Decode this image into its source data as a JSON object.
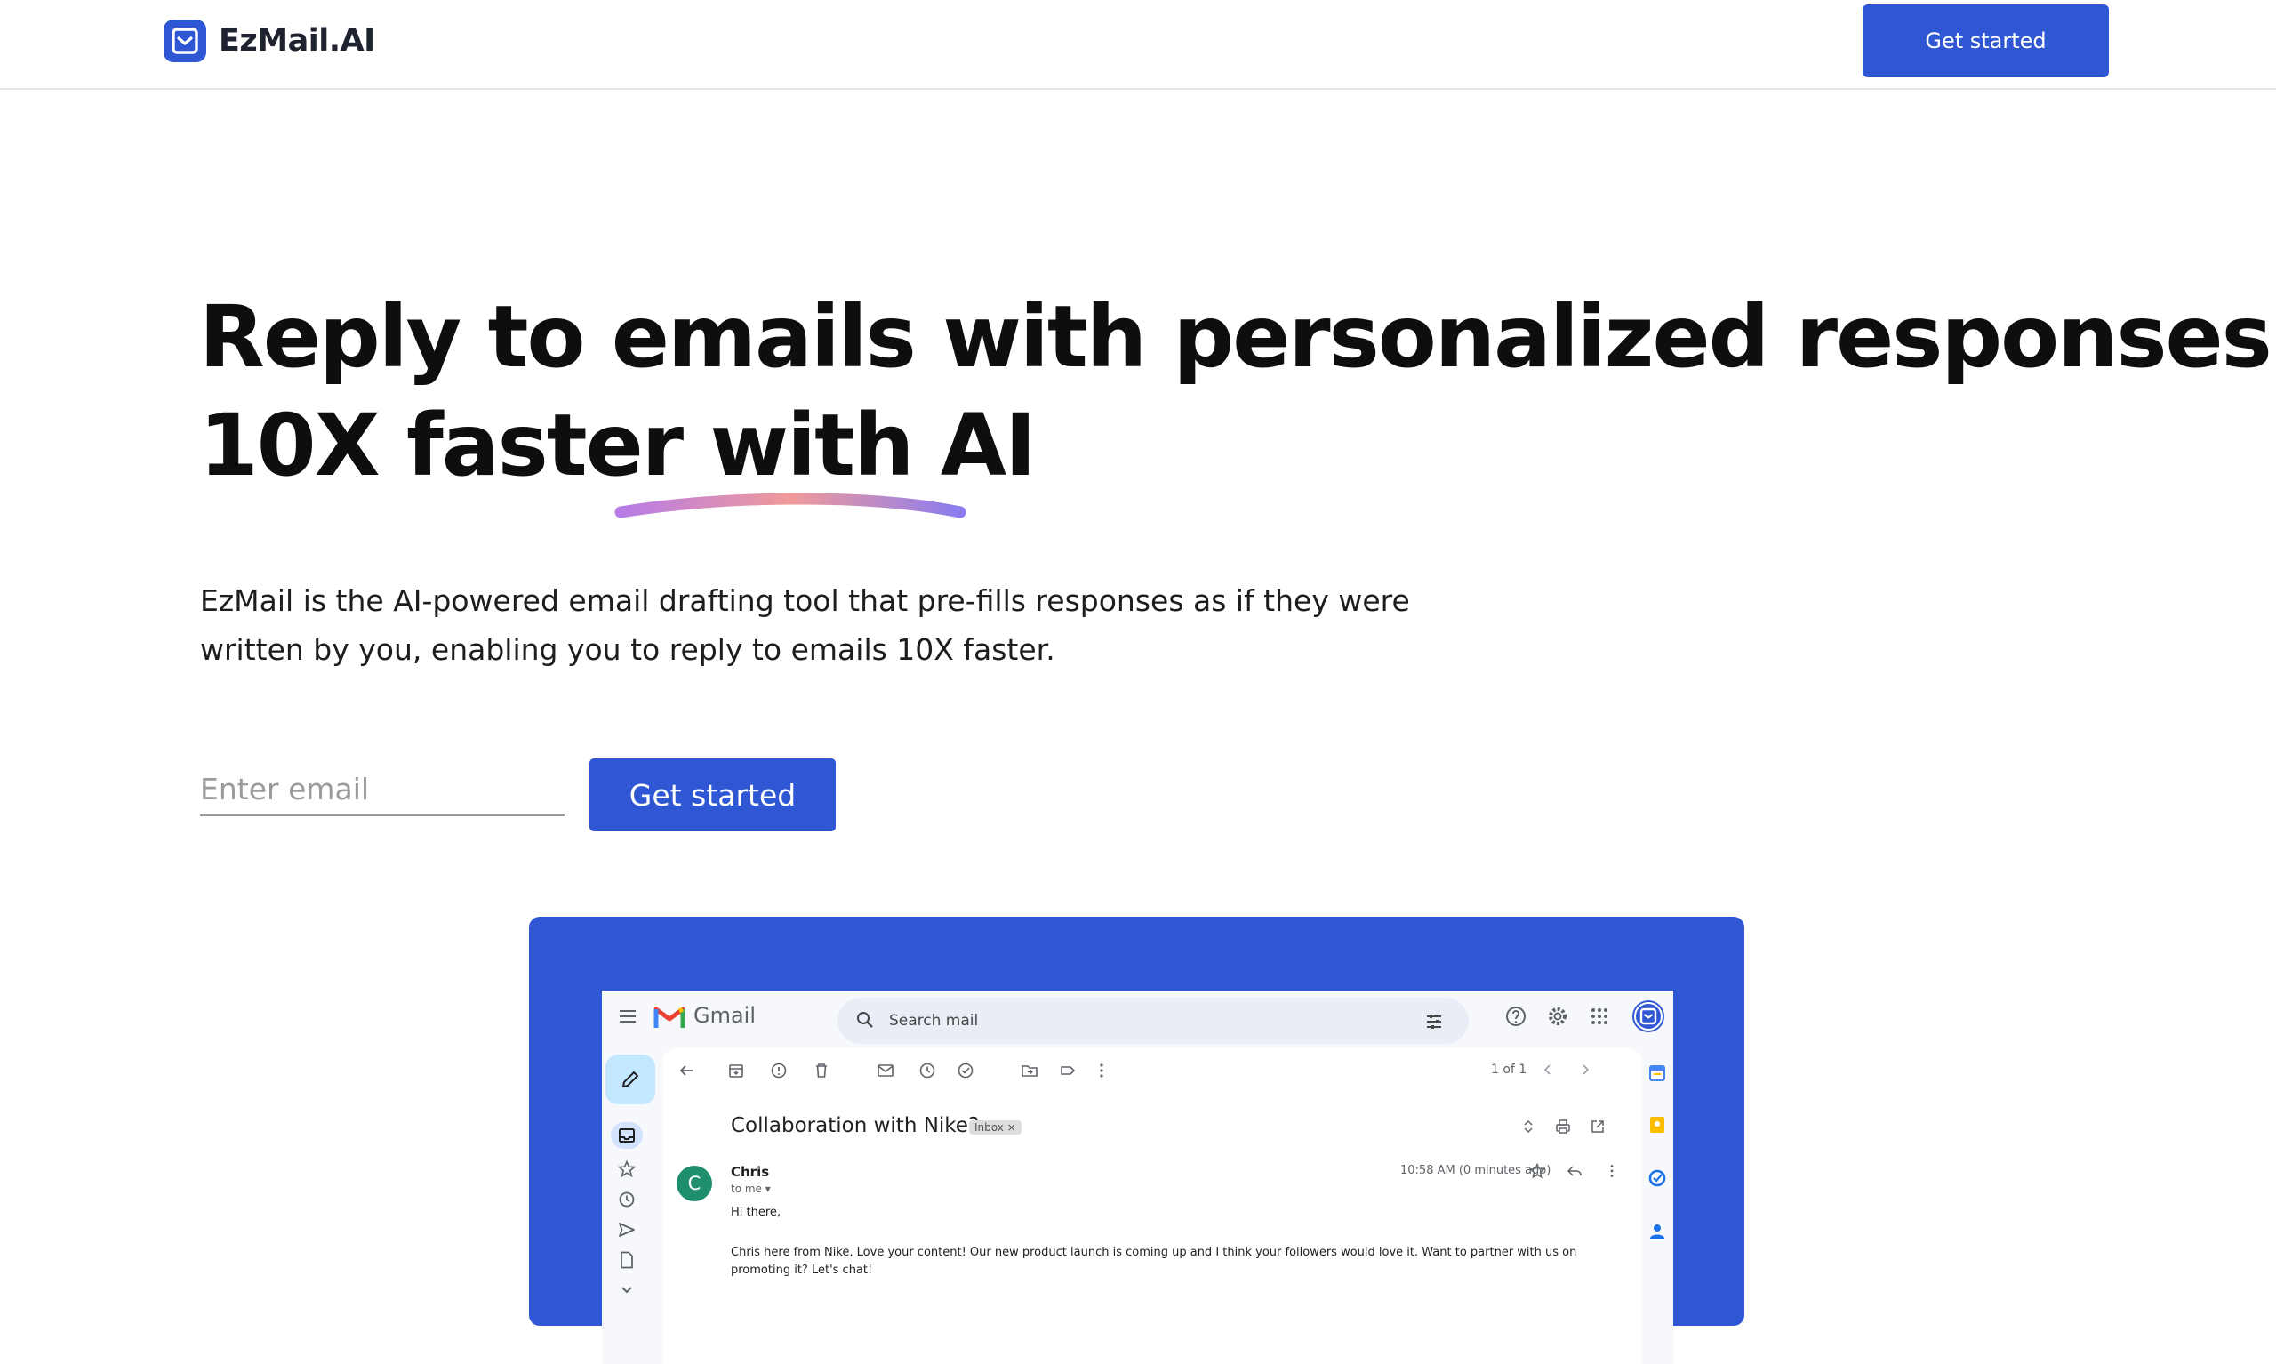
{
  "nav": {
    "brand": "EzMail.AI",
    "cta_label": "Get started"
  },
  "hero": {
    "title_line1": "Reply to emails  with personalized responses",
    "title_line2": "10X faster with AI",
    "subtitle": "EzMail is the AI-powered email drafting tool that pre-fills responses as if they were written by you, enabling you to reply to emails 10X faster.",
    "email_placeholder": "Enter email",
    "cta_label": "Get started"
  },
  "preview": {
    "app_name": "Gmail",
    "search_placeholder": "Search mail",
    "pagination": "1 of 1",
    "subject": "Collaboration with Nike?",
    "label_tag": "Inbox ×",
    "sender_initial": "C",
    "sender_name": "Chris",
    "recipient": "to me ▾",
    "time": "10:58 AM (0 minutes ago)",
    "greeting": "Hi there,",
    "body": "Chris here from  Nike. Love your content! Our new product launch is coming up and I think your followers would love it. Want to partner with us on promoting it? Let's chat!"
  },
  "colors": {
    "brand_blue": "#2f56d3",
    "underline_gradient": [
      "#b77ce6",
      "#f09a9a",
      "#8a7cef"
    ]
  }
}
